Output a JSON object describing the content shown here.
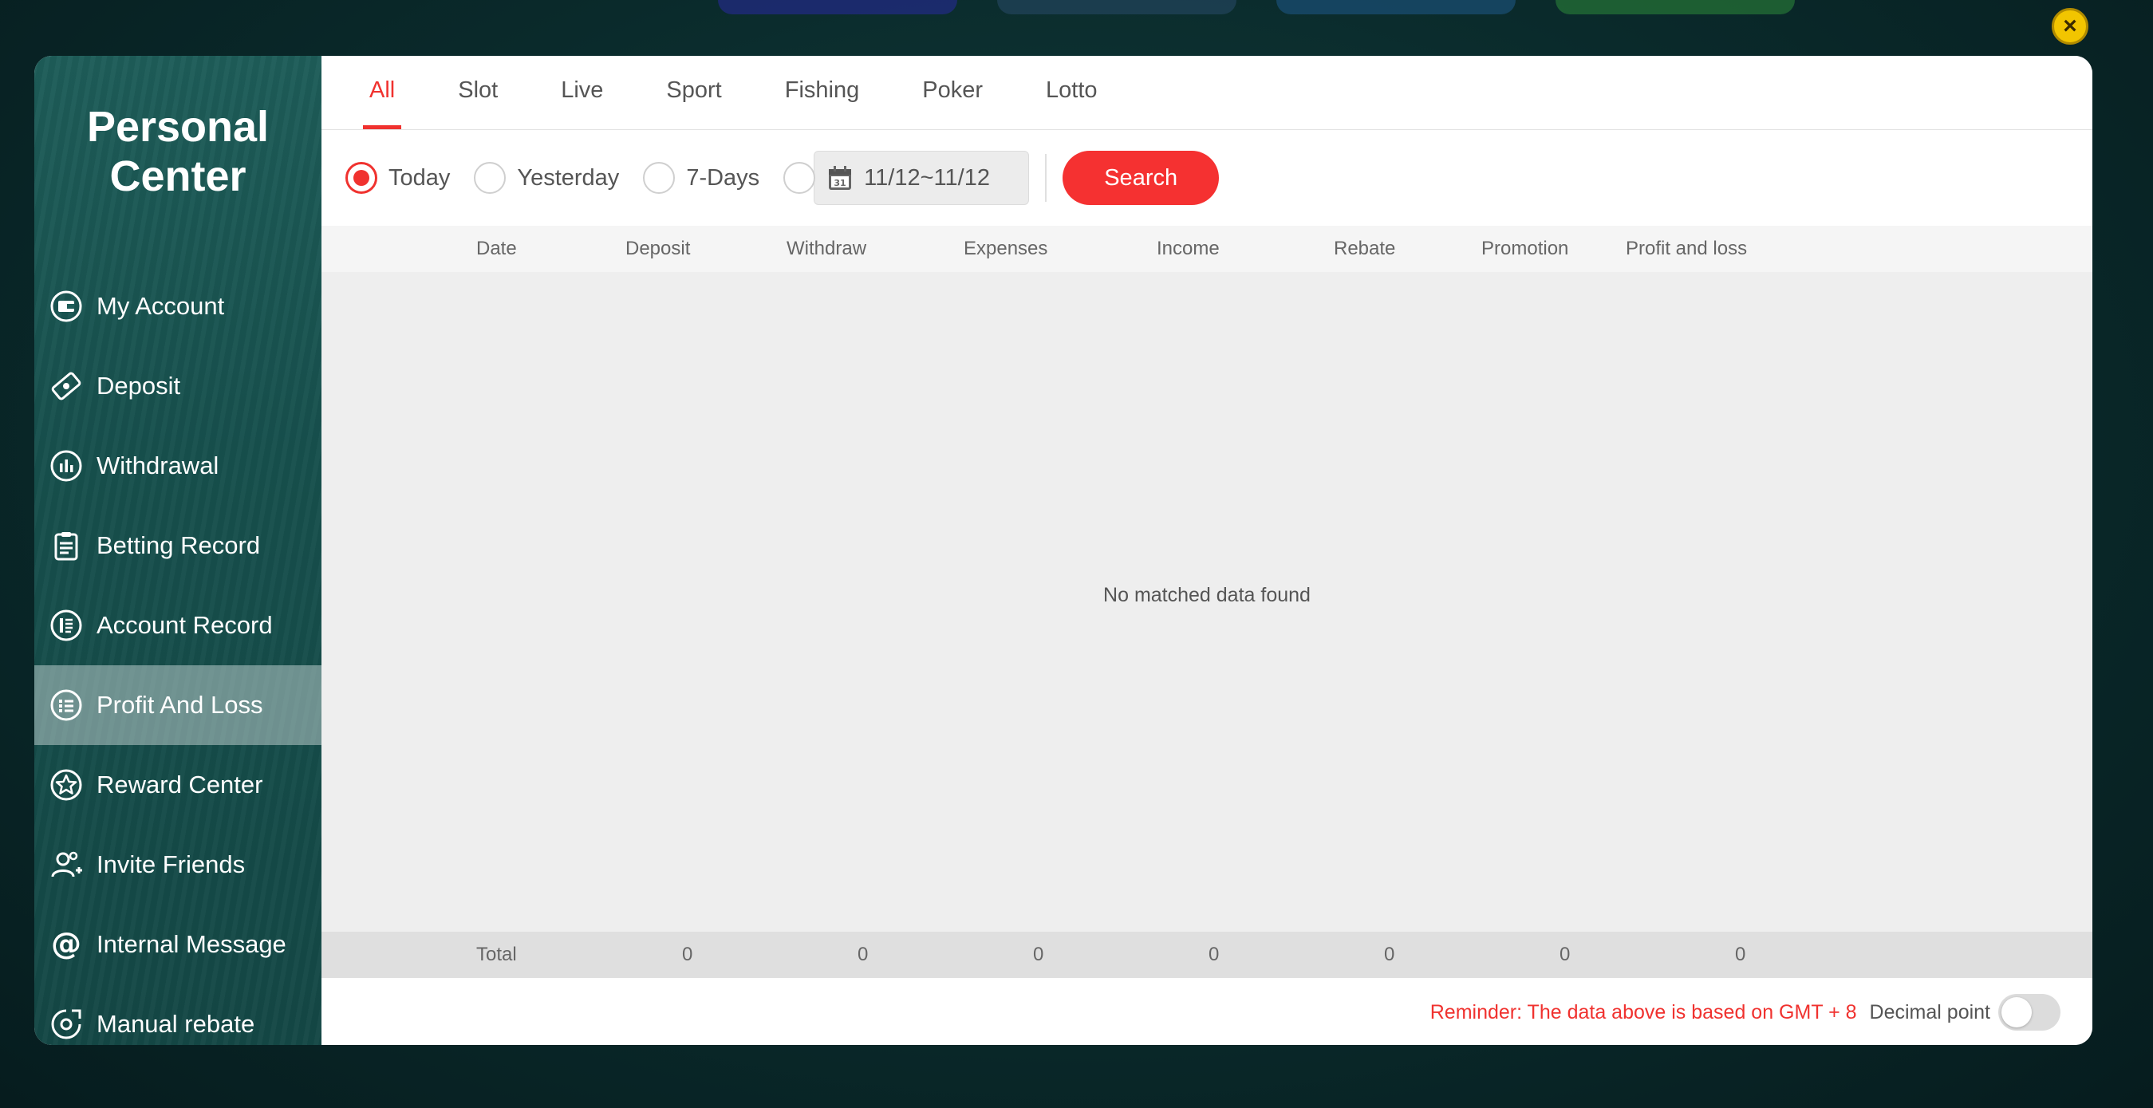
{
  "sidebar": {
    "title_line1": "Personal",
    "title_line2": "Center",
    "items": [
      {
        "label": "My Account",
        "icon": "wallet-icon"
      },
      {
        "label": "Deposit",
        "icon": "deposit-icon"
      },
      {
        "label": "Withdrawal",
        "icon": "bar-chart-icon"
      },
      {
        "label": "Betting Record",
        "icon": "clipboard-icon"
      },
      {
        "label": "Account Record",
        "icon": "ledger-icon"
      },
      {
        "label": "Profit And Loss",
        "icon": "list-icon",
        "active": true
      },
      {
        "label": "Reward Center",
        "icon": "star-icon"
      },
      {
        "label": "Invite Friends",
        "icon": "add-user-icon"
      },
      {
        "label": "Internal Message",
        "icon": "at-icon"
      },
      {
        "label": "Manual rebate",
        "icon": "rebate-icon"
      }
    ]
  },
  "tabs": [
    {
      "label": "All",
      "active": true
    },
    {
      "label": "Slot"
    },
    {
      "label": "Live"
    },
    {
      "label": "Sport"
    },
    {
      "label": "Fishing"
    },
    {
      "label": "Poker"
    },
    {
      "label": "Lotto"
    }
  ],
  "filters": {
    "today": "Today",
    "yesterday": "Yesterday",
    "seven_days": "7-Days",
    "date_range": "11/12~11/12",
    "search": "Search",
    "selected": "today"
  },
  "table": {
    "headers": [
      "Date",
      "Deposit",
      "Withdraw",
      "Expenses",
      "Income",
      "Rebate",
      "Promotion",
      "Profit and loss"
    ],
    "empty_message": "No matched data found",
    "total_label": "Total",
    "totals": [
      "0",
      "0",
      "0",
      "0",
      "0",
      "0",
      "0"
    ]
  },
  "footer": {
    "reminder": "Reminder: The data above is based on GMT + 8",
    "decimal_label": "Decimal point",
    "decimal_on": false
  },
  "colors": {
    "accent": "#f0322f",
    "sidebar": "#17504d",
    "close": "#f2c500"
  }
}
